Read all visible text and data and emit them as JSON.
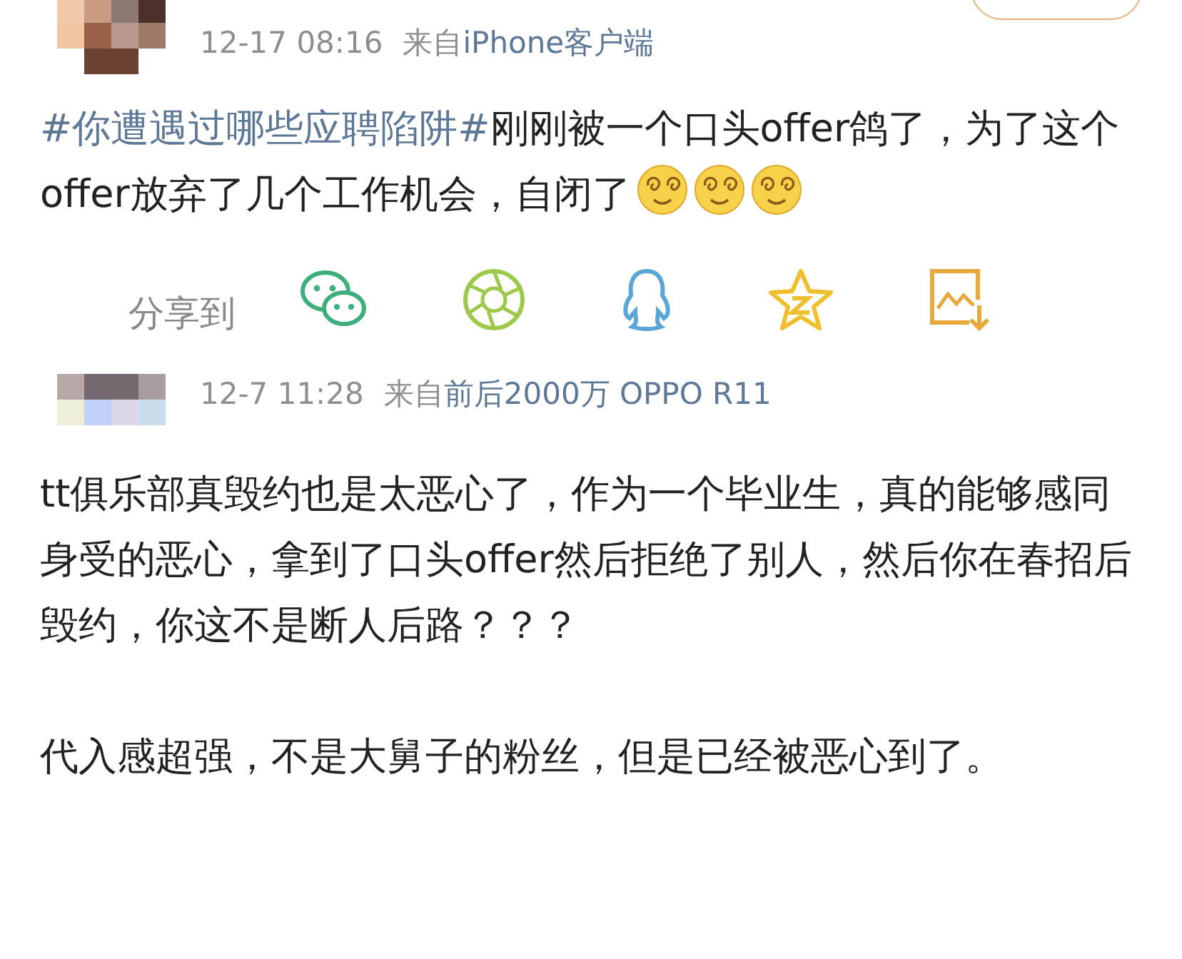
{
  "posts": [
    {
      "time": "12-17 08:16",
      "source_prefix": "来自",
      "source": "iPhone客户端",
      "hashtag": "#你遭遇过哪些应聘陷阱#",
      "paragraphs": [
        "刚刚被一个口头offer鸽了，为了这个offer放弃了几个工作机会，自闭了"
      ],
      "emojis": [
        {
          "kind": "dizzy"
        },
        {
          "kind": "dizzy"
        },
        {
          "kind": "dizzy"
        }
      ]
    },
    {
      "time": "12-7 11:28",
      "source_prefix": "来自",
      "source": "前后2000万 OPPO R11",
      "paragraphs": [
        "tt俱乐部真毁约也是太恶心了，作为一个毕业生，真的能够感同身受的恶心，拿到了口头offer然后拒绝了别人，然后你在春招后毁约，你这不是断人后路？？？",
        "代入感超强，不是大舅子的粉丝，但是已经被恶心到了。"
      ]
    }
  ],
  "share_bar": {
    "label": "分享到",
    "targets": [
      {
        "kind": "wechat"
      },
      {
        "kind": "moments"
      },
      {
        "kind": "qq"
      },
      {
        "kind": "qzone"
      },
      {
        "kind": "save-image"
      }
    ]
  }
}
